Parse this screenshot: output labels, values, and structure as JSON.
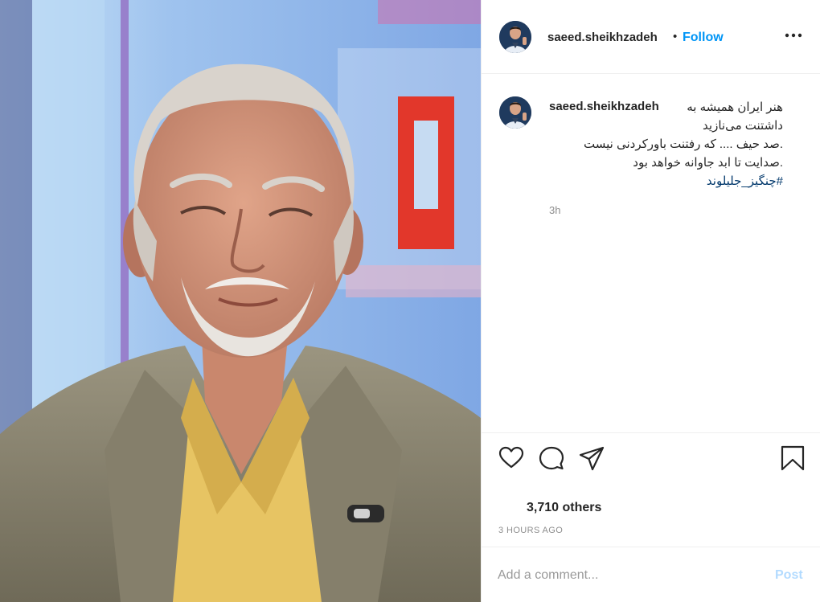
{
  "post": {
    "image_alt": "",
    "author": {
      "username": "saeed.sheikhzadeh",
      "follow_label": "Follow",
      "separator": "•"
    },
    "caption": {
      "username": "saeed.sheikhzadeh",
      "lines": [
        "هنر ایران همیشه به",
        "داشتنت می‌نازید",
        ".صد حیف .... که رفتنت باورکردنی نیست",
        ".صدایت تا ابد جاوانه خواهد بود"
      ],
      "hashtag": "#چنگیز_جلیلوند",
      "time_ago": "3h"
    },
    "icons": {
      "more": "more-options-icon",
      "like": "heart-icon",
      "comment": "comment-icon",
      "share": "share-icon",
      "save": "bookmark-icon"
    },
    "likes_text": "3,710 others",
    "posted_time": "3 HOURS AGO",
    "comment": {
      "placeholder": "Add a comment...",
      "value": "",
      "post_label": "Post"
    },
    "colors": {
      "accent": "#0095f6",
      "post_disabled": "#b3dbff",
      "text": "#262626",
      "secondary": "#8e8e8e"
    }
  }
}
